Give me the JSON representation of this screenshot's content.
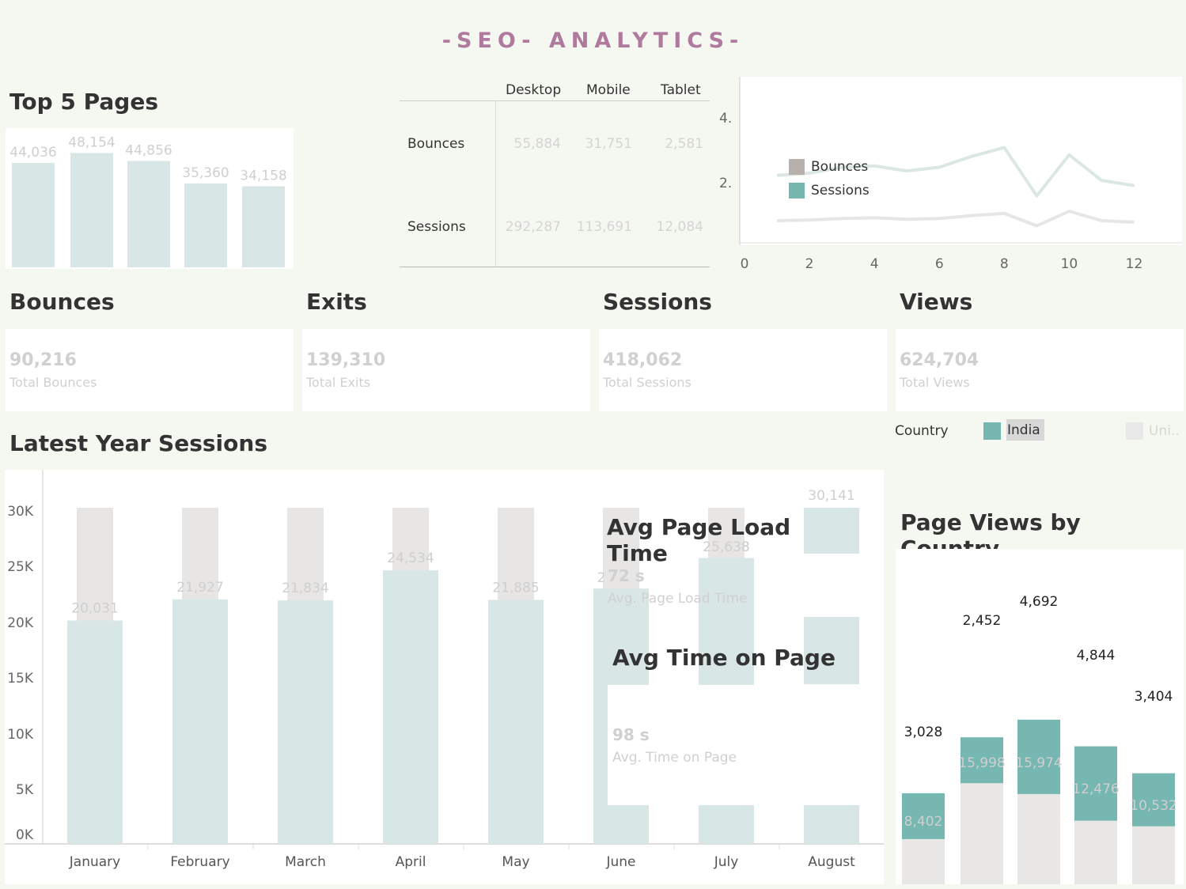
{
  "dashboard": {
    "title": "-SEO- ANALYTICS-"
  },
  "top_pages": {
    "title": "Top 5 Pages",
    "chart_data": {
      "type": "bar",
      "values": [
        44036,
        48154,
        44856,
        35360,
        34158
      ],
      "labels": [
        "44,036",
        "48,154",
        "44,856",
        "35,360",
        "34,158"
      ]
    }
  },
  "device_table": {
    "columns": [
      "Desktop",
      "Mobile",
      "Tablet"
    ],
    "rows": [
      {
        "label": "Bounces",
        "values": [
          "55,884",
          "31,751",
          "2,581"
        ]
      },
      {
        "label": "Sessions",
        "values": [
          "292,287",
          "113,691",
          "12,084"
        ]
      }
    ]
  },
  "line_chart": {
    "legend": [
      "Bounces",
      "Sessions"
    ],
    "colors": {
      "Bounces": "#b8b0ac",
      "Sessions": "#76b7b2"
    },
    "chart_data": {
      "type": "line",
      "x_ticks": [
        "0",
        "2",
        "4",
        "6",
        "8",
        "10",
        "12"
      ],
      "y_ticks": [
        "4.",
        "2."
      ],
      "series": [
        {
          "name": "Sessions",
          "x": [
            1,
            2,
            3,
            4,
            5,
            6,
            7,
            8,
            9,
            10,
            11,
            12
          ],
          "y": [
            3.8,
            3.95,
            4.35,
            4.45,
            4.1,
            4.35,
            5.1,
            5.7,
            2.4,
            5.2,
            3.45,
            3.1
          ]
        },
        {
          "name": "Bounces",
          "x": [
            1,
            2,
            3,
            4,
            5,
            6,
            7,
            8,
            9,
            10,
            11,
            12
          ],
          "y": [
            0.7,
            0.75,
            0.85,
            0.9,
            0.8,
            0.85,
            1.05,
            1.2,
            0.35,
            1.35,
            0.7,
            0.6
          ]
        }
      ],
      "xlim": [
        0,
        12.5
      ]
    }
  },
  "kpis": [
    {
      "title": "Bounces",
      "value": "90,216",
      "sub": "Total Bounces"
    },
    {
      "title": "Exits",
      "value": "139,310",
      "sub": "Total Exits"
    },
    {
      "title": "Sessions",
      "value": "418,062",
      "sub": "Total Sessions"
    },
    {
      "title": "Views",
      "value": "624,704",
      "sub": "Total Views"
    }
  ],
  "country_filter": {
    "label": "Country",
    "items": [
      {
        "name": "India",
        "color": "#76b7b2"
      },
      {
        "name": "Uni..",
        "color": "#e8e8e8"
      }
    ]
  },
  "latest_year": {
    "title": "Latest Year Sessions",
    "chart_data": {
      "type": "bar",
      "categories": [
        "January",
        "February",
        "March",
        "April",
        "May",
        "June",
        "July",
        "August"
      ],
      "values": [
        20031,
        21927,
        21834,
        24534,
        21885,
        22900,
        25638,
        30141
      ],
      "labels": [
        "20,031",
        "21,927",
        "21,834",
        "24,534",
        "21,885",
        "2",
        "25,638",
        "30,141"
      ],
      "y_ticks": [
        "30K",
        "25K",
        "20K",
        "15K",
        "10K",
        "5K",
        "0K"
      ],
      "ylim": [
        0,
        33500
      ]
    }
  },
  "avg_load": {
    "title": "Avg Page Load Time",
    "value": "72 s",
    "sub": "Avg. Page Load Time"
  },
  "avg_time": {
    "title": "Avg Time on Page",
    "value": "98 s",
    "sub": "Avg. Time on Page"
  },
  "page_views_country": {
    "title": "Page Views by Country",
    "chart_data": {
      "type": "bar",
      "series": [
        {
          "name": "India",
          "values": [
            3028,
            2452,
            4692,
            4844,
            3404
          ],
          "labels": [
            "3,028",
            "2,452",
            "4,692",
            "4,844",
            "3,404"
          ]
        },
        {
          "name": "Uni..",
          "values": [
            8402,
            15998,
            15974,
            12476,
            10532
          ],
          "labels": [
            "8,402",
            "15,998",
            "15,974",
            "12,476",
            "10,532"
          ]
        }
      ]
    }
  }
}
